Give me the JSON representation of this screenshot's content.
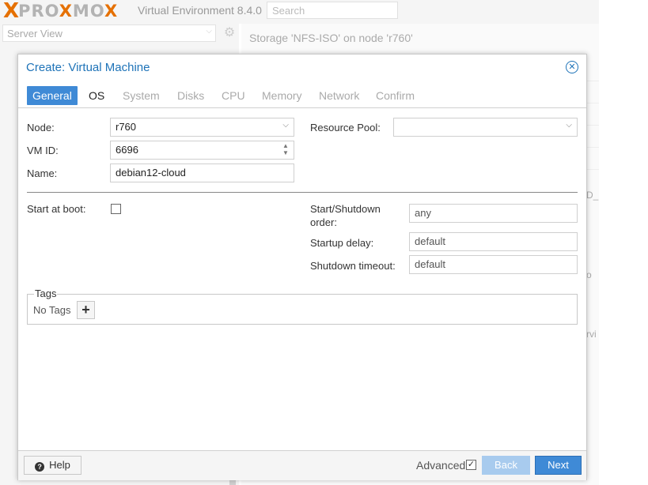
{
  "app": {
    "logo_x": "X",
    "logo_text_a": "PRO",
    "logo_text_b": "X",
    "logo_text_c": "MO",
    "logo_text_d": "X",
    "version": "Virtual Environment 8.4.0",
    "search_placeholder": "Search",
    "server_view": "Server View",
    "storage_title": "Storage 'NFS-ISO' on node 'r760'",
    "bg_fragments": [
      "D_",
      "o",
      "rvi"
    ]
  },
  "dialog": {
    "title": "Create: Virtual Machine",
    "tabs": [
      {
        "label": "General",
        "state": "active"
      },
      {
        "label": "OS",
        "state": "enabled"
      },
      {
        "label": "System",
        "state": "disabled"
      },
      {
        "label": "Disks",
        "state": "disabled"
      },
      {
        "label": "CPU",
        "state": "disabled"
      },
      {
        "label": "Memory",
        "state": "disabled"
      },
      {
        "label": "Network",
        "state": "disabled"
      },
      {
        "label": "Confirm",
        "state": "disabled"
      }
    ],
    "general": {
      "node_label": "Node:",
      "node_value": "r760",
      "vmid_label": "VM ID:",
      "vmid_value": "6696",
      "name_label": "Name:",
      "name_value": "debian12-cloud",
      "pool_label": "Resource Pool:",
      "pool_value": "",
      "start_boot_label": "Start at boot:",
      "order_label_1": "Start/Shutdown",
      "order_label_2": "order:",
      "order_value": "any",
      "startup_delay_label": "Startup delay:",
      "startup_delay_value": "default",
      "shutdown_timeout_label": "Shutdown timeout:",
      "shutdown_timeout_value": "default",
      "tags_legend": "Tags",
      "no_tags": "No Tags"
    },
    "footer": {
      "help_label": "Help",
      "advanced_label": "Advanced",
      "advanced_checked": true,
      "back_label": "Back",
      "next_label": "Next"
    }
  },
  "colors": {
    "accent": "#3f8ad6",
    "title_blue": "#1e73b8",
    "logo_orange": "#e57000"
  }
}
